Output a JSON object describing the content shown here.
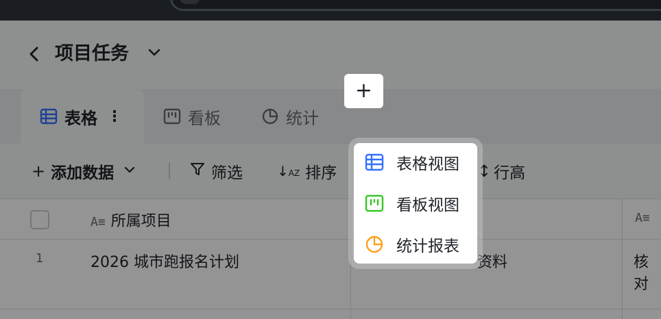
{
  "header": {
    "back_icon": "chevron-left-icon",
    "title": "项目任务",
    "title_caret": "chevron-down-icon"
  },
  "tabs": [
    {
      "label": "表格",
      "icon": "table-icon",
      "active": true,
      "more": "⋮"
    },
    {
      "label": "看板",
      "icon": "kanban-icon",
      "active": false
    },
    {
      "label": "统计",
      "icon": "pie-chart-icon",
      "active": false
    }
  ],
  "add_tab": {
    "label": "+"
  },
  "toolbar": {
    "add_data": "添加数据",
    "filter": "筛选",
    "sort": "排序",
    "row_height": "行高"
  },
  "table": {
    "columns": [
      {
        "label": "所属项目"
      }
    ],
    "rows": [
      {
        "index": "1",
        "project": "2026 城市跑报名计划",
        "col2": "资料",
        "col3": "核对"
      }
    ]
  },
  "menu": {
    "items": [
      {
        "label": "表格视图",
        "icon": "table-icon",
        "color": "#3370ff"
      },
      {
        "label": "看板视图",
        "icon": "kanban-icon",
        "color": "#34c724"
      },
      {
        "label": "统计报表",
        "icon": "pie-chart-icon",
        "color": "#ffa01a"
      }
    ]
  }
}
